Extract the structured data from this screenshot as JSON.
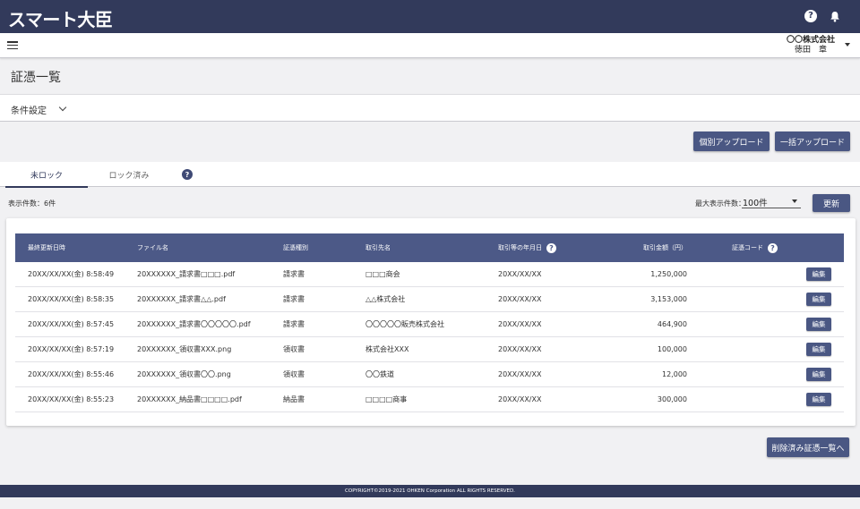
{
  "app": {
    "logo": "スマート大臣"
  },
  "topbar": {
    "help_icon": "help-circle-icon",
    "bell_icon": "bell-icon"
  },
  "subbar": {
    "menu_icon": "hamburger-icon",
    "company": "〇〇株式会社",
    "user": "徳田　章"
  },
  "page": {
    "title": "証憑一覧"
  },
  "conditions": {
    "label": "条件設定"
  },
  "actions": {
    "individual_upload": "個別アップロード",
    "bulk_upload": "一括アップロード"
  },
  "tabs": {
    "unlocked": "未ロック",
    "locked": "ロック済み"
  },
  "list": {
    "count_label": "表示件数：6件",
    "max_label": "最大表示件数：",
    "max_value": "100件",
    "refresh": "更新"
  },
  "table": {
    "headers": {
      "updated": "最終更新日時",
      "file": "ファイル名",
      "type": "証憑種別",
      "partner": "取引先名",
      "date": "取引等の年月日",
      "amount": "取引金額（円）",
      "code": "証憑コード"
    },
    "edit_label": "編集",
    "rows": [
      {
        "updated": "20XX/XX/XX(金) 8:58:49",
        "file": "20XXXXXX_請求書□□□.pdf",
        "type": "請求書",
        "partner": "□□□商会",
        "date": "20XX/XX/XX",
        "amount": "1,250,000"
      },
      {
        "updated": "20XX/XX/XX(金) 8:58:35",
        "file": "20XXXXXX_請求書△△.pdf",
        "type": "請求書",
        "partner": "△△株式会社",
        "date": "20XX/XX/XX",
        "amount": "3,153,000"
      },
      {
        "updated": "20XX/XX/XX(金) 8:57:45",
        "file": "20XXXXXX_請求書〇〇〇〇〇.pdf",
        "type": "請求書",
        "partner": "〇〇〇〇〇販売株式会社",
        "date": "20XX/XX/XX",
        "amount": "464,900"
      },
      {
        "updated": "20XX/XX/XX(金) 8:57:19",
        "file": "20XXXXXX_領収書XXX.png",
        "type": "領収書",
        "partner": "株式会社XXX",
        "date": "20XX/XX/XX",
        "amount": "100,000"
      },
      {
        "updated": "20XX/XX/XX(金) 8:55:46",
        "file": "20XXXXXX_領収書〇〇.png",
        "type": "領収書",
        "partner": "〇〇鉄道",
        "date": "20XX/XX/XX",
        "amount": "12,000"
      },
      {
        "updated": "20XX/XX/XX(金) 8:55:23",
        "file": "20XXXXXX_納品書□□□□.pdf",
        "type": "納品書",
        "partner": "□□□□商事",
        "date": "20XX/XX/XX",
        "amount": "300,000"
      }
    ]
  },
  "deleted_list_button": "削除済み証憑一覧へ",
  "footer": {
    "copyright": "COPYRIGHT©2019-2021 OHKEN Corporation ALL RIGHTS RESERVED."
  },
  "colors": {
    "navy": "#323a5b",
    "button": "#4a5783",
    "table_header": "#4c5987",
    "background": "#f1f1f3"
  }
}
